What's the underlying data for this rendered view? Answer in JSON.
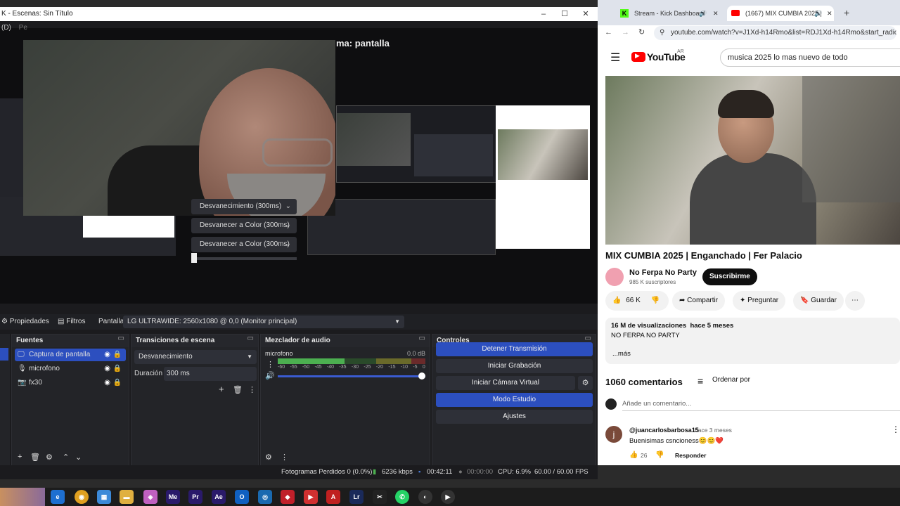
{
  "obs": {
    "window_title": "K - Escenas: Sin Título",
    "menu_partial": "(D)",
    "menu_partial2": "Pe",
    "program_label": "ma: pantalla",
    "transitions": [
      "Desvanecimiento (300ms)",
      "Desvanecer a Color (300ms)",
      "Desvanecer a Color (300ms)"
    ],
    "propbar": {
      "properties": "Propiedades",
      "filters": "Filtros",
      "screen_label": "Pantalla",
      "screen_value": "LG ULTRAWIDE: 2560x1080 @ 0,0 (Monitor principal)"
    },
    "sources": {
      "title": "Fuentes",
      "items": [
        "Captura de pantalla",
        "microfono",
        "fx30"
      ]
    },
    "scene_transitions": {
      "title": "Transiciones de escena",
      "selected": "Desvanecimiento",
      "duration_label": "Duración",
      "duration_value": "300 ms"
    },
    "mixer": {
      "title": "Mezclador de audio",
      "channel": "microfono",
      "db": "0.0 dB",
      "ticks": [
        "-60",
        "-55",
        "-50",
        "-45",
        "-40",
        "-35",
        "-30",
        "-25",
        "-20",
        "-15",
        "-10",
        "-5",
        "0"
      ],
      "level": 0.45
    },
    "controls": {
      "title": "Controles",
      "stop_stream": "Detener Transmisión",
      "start_rec": "Iniciar Grabación",
      "virtual_cam": "Iniciar Cámara Virtual",
      "studio_mode": "Modo Estudio",
      "settings": "Ajustes"
    },
    "status": {
      "dropped": "Fotogramas Perdidos 0 (0.0%)",
      "kbps": "6236 kbps",
      "live_time": "00:42:11",
      "rec_time": "00:00:00",
      "cpu": "CPU: 6.9%",
      "fps": "60.00 / 60.00 FPS"
    }
  },
  "browser": {
    "tabs": [
      "Stream - Kick Dashboard",
      "(1667) MIX CUMBIA 2025 |"
    ],
    "url": "youtube.com/watch?v=J1Xd-h14Rmo&list=RDJ1Xd-h14Rmo&start_radio...",
    "logo_text": "YouTube",
    "logo_region": "AR",
    "search_query": "musica 2025 lo mas nuevo de todo",
    "video_title": "MIX CUMBIA 2025 | Enganchado | Fer Palacio",
    "channel_name": "No Ferpa No Party",
    "subscribers": "985 K suscriptores",
    "subscribe": "Suscribirme",
    "likes": "66 K",
    "share": "Compartir",
    "ask": "Preguntar",
    "save": "Guardar",
    "views": "16 M de visualizaciones",
    "when": "hace 5 meses",
    "desc": "NO FERPA NO PARTY",
    "more": "...más",
    "comments_count": "1060 comentarios",
    "sort": "Ordenar por",
    "add_comment": "Añade un comentario...",
    "comment": {
      "author": "@juancarlosbarbosa15",
      "when": "hace 3 meses",
      "text": "Buenisimas csncioness😊😊❤️",
      "likes": "26",
      "reply": "Responder"
    }
  },
  "colors": {
    "obs_blue": "#2c4fbf",
    "yt_red": "#ff0000",
    "kick_green": "#53fc18"
  }
}
